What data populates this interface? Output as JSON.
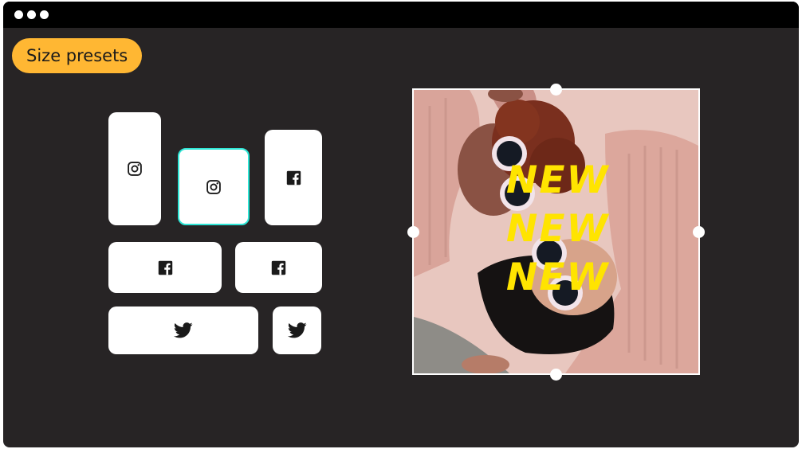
{
  "badge": {
    "label": "Size presets",
    "color": "#ffb733"
  },
  "presets": [
    {
      "platform": "instagram",
      "icon": "instagram-icon"
    },
    {
      "platform": "instagram",
      "icon": "instagram-icon",
      "selected": true
    },
    {
      "platform": "facebook",
      "icon": "facebook-icon"
    },
    {
      "platform": "facebook",
      "icon": "facebook-icon"
    },
    {
      "platform": "facebook",
      "icon": "facebook-icon"
    },
    {
      "platform": "twitter",
      "icon": "twitter-icon"
    },
    {
      "platform": "twitter",
      "icon": "twitter-icon"
    }
  ],
  "canvas": {
    "overlay_lines": [
      "NEW",
      "NEW",
      "NEW"
    ],
    "overlay_color": "#ffe400",
    "image": "two-people-in-pink-sweaters-and-sunglasses"
  },
  "colors": {
    "background": "#272425",
    "titlebar": "#000000",
    "selection": "#2ee6d6"
  }
}
